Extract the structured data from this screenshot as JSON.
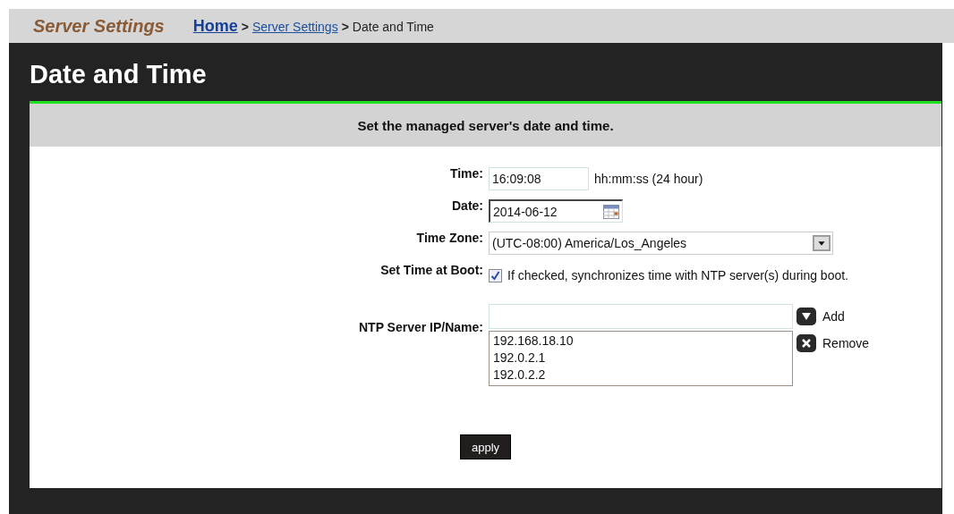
{
  "header": {
    "section": "Server Settings",
    "breadcrumb": [
      {
        "kind": "home",
        "label": "Home"
      },
      {
        "kind": "separator",
        "label": ">"
      },
      {
        "kind": "link",
        "label": "Server Settings"
      },
      {
        "kind": "separator",
        "label": ">"
      },
      {
        "kind": "current",
        "label": "Date and Time"
      }
    ]
  },
  "page_title": "Date and Time",
  "panel": {
    "heading": "Set the managed server's date and time.",
    "fields": [
      {
        "kind": "text",
        "label": "Time:",
        "value": "16:09:08",
        "hint": "hh:mm:ss (24 hour)"
      },
      {
        "kind": "date",
        "label": "Date:",
        "value": "2014-06-12"
      },
      {
        "kind": "select",
        "label": "Time Zone:",
        "value": "(UTC-08:00) America/Los_Angeles"
      },
      {
        "kind": "checkbox",
        "label": "Set Time at Boot:",
        "checked": true,
        "description": "If checked, synchronizes time with NTP server(s) during boot."
      },
      {
        "kind": "ntp",
        "label": "NTP Server IP/Name:",
        "servers": [
          "192.168.18.10",
          "192.0.2.1",
          "192.0.2.2"
        ],
        "add_button": "Add",
        "remove_button": "Remove"
      }
    ],
    "apply_button": "apply"
  }
}
